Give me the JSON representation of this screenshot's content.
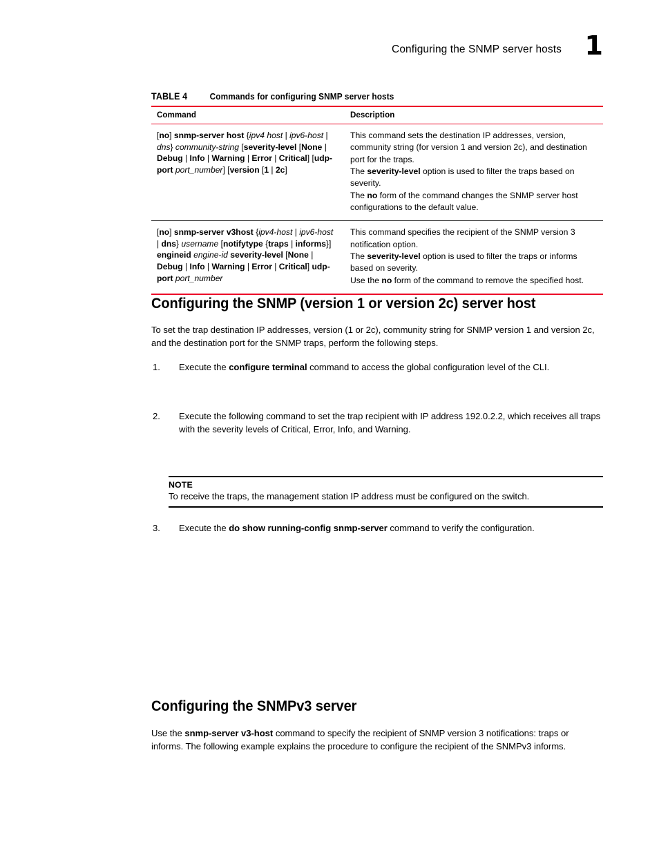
{
  "header": {
    "title": "Configuring the SNMP server hosts",
    "page_number": "1"
  },
  "table": {
    "caption_label": "TABLE 4",
    "caption_text": "Commands for configuring SNMP server hosts",
    "columns": [
      "Command",
      "Description"
    ],
    "accent_color": "#ec0928",
    "rows": [
      {
        "command_plain": "[no] snmp-server host {ipv4 host | ipv6-host | dns} community-string [severity-level [None | Debug | Info | Warning | Error | Critical] [udp-port port_number] [version [1 | 2c]",
        "description_paragraphs": [
          "This command sets the destination IP addresses, version, community string (for version 1 and version 2c), and destination port for the traps.",
          "The severity-level option is used to filter the traps based on severity.",
          "The no form of the command changes the SNMP server host configurations to the default value."
        ]
      },
      {
        "command_plain": "[no] snmp-server v3host {ipv4-host | ipv6-host | dns} username [notifytype {traps | informs}] engineid engine-id severity-level [None | Debug | Info | Warning | Error | Critical] udp-port port_number",
        "description_paragraphs": [
          "This command specifies the recipient of the SNMP version 3 notification option.",
          "The severity-level option is used to filter the traps or informs based on severity.",
          "Use the no form of the command to remove the specified host."
        ]
      }
    ]
  },
  "sections": [
    {
      "heading": "Configuring the SNMP (version 1 or version 2c) server host",
      "intro": "To set the trap destination IP addresses, version (1 or 2c), community string for SNMP version 1 and version 2c, and the destination port for the SNMP traps, perform the following steps.",
      "steps": [
        {
          "number": "1.",
          "text_plain": "Execute the configure terminal command to access the global configuration level of the CLI."
        },
        {
          "number": "2.",
          "text_plain": "Execute the following command to set the trap recipient with IP address 192.0.2.2, which receives all traps with the severity levels of Critical, Error, Info, and Warning."
        },
        {
          "number": "3.",
          "text_plain": "Execute the do show running-config snmp-server command to verify the configuration."
        }
      ]
    },
    {
      "heading": "Configuring the SNMPv3 server",
      "intro_plain": "Use the snmp-server v3-host command to specify the recipient of SNMP version 3 notifications: traps or informs. The following example explains the procedure to configure the recipient of the SNMPv3 informs."
    }
  ],
  "note": {
    "label": "NOTE",
    "text": "To receive the traps, the management station IP address must be configured on the switch."
  }
}
